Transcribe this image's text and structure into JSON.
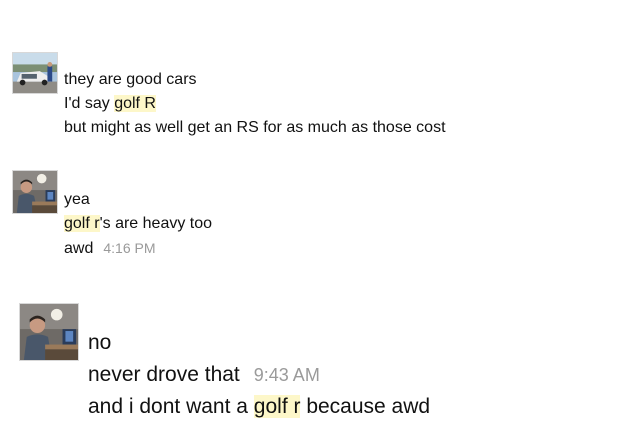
{
  "messages": [
    {
      "avatar_icon": "car-photo-avatar",
      "lines": [
        {
          "parts": [
            {
              "text": "they are good cars",
              "hl": false
            }
          ]
        },
        {
          "parts": [
            {
              "text": "I'd say ",
              "hl": false
            },
            {
              "text": "golf R",
              "hl": true
            }
          ]
        },
        {
          "parts": [
            {
              "text": "but might as well get an RS for as much as those cost",
              "hl": false
            }
          ]
        }
      ]
    },
    {
      "avatar_icon": "person-at-desk-avatar",
      "lines": [
        {
          "parts": [
            {
              "text": "yea",
              "hl": false
            }
          ]
        },
        {
          "parts": [
            {
              "text": "golf r",
              "hl": true
            },
            {
              "text": "'s are heavy too",
              "hl": false
            }
          ]
        },
        {
          "parts": [
            {
              "text": "awd",
              "hl": false
            }
          ],
          "timestamp": "4:16 PM"
        }
      ]
    },
    {
      "avatar_icon": "person-at-desk-avatar",
      "lines": [
        {
          "parts": [
            {
              "text": "no",
              "hl": false
            }
          ]
        },
        {
          "parts": [
            {
              "text": "never drove that",
              "hl": false
            }
          ],
          "timestamp": "9:43 AM"
        },
        {
          "parts": [
            {
              "text": "and i dont want a ",
              "hl": false
            },
            {
              "text": "golf r",
              "hl": true
            },
            {
              "text": " because awd",
              "hl": false
            }
          ]
        }
      ]
    }
  ],
  "colors": {
    "highlight": "#fdf7c9",
    "timestamp": "#9a9a9a",
    "text": "#111111"
  }
}
